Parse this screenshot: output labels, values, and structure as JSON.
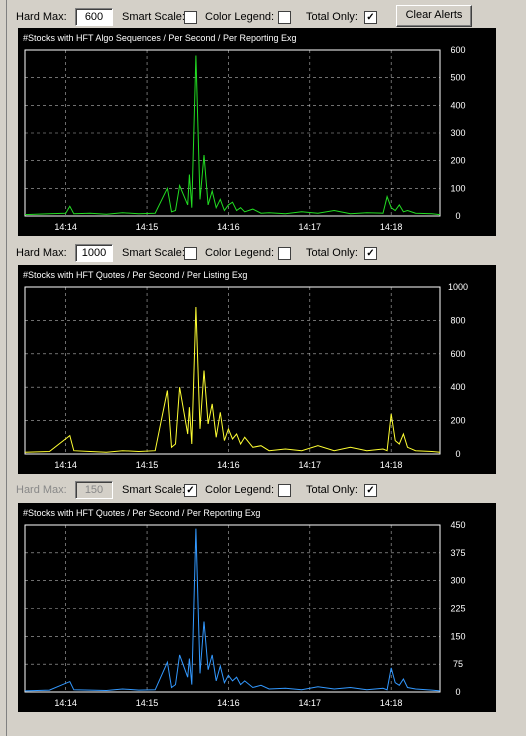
{
  "toolbar": {
    "clear_alerts_label": "Clear Alerts"
  },
  "panels": [
    {
      "controls": {
        "hard_max_label": "Hard Max:",
        "hard_max_value": "600",
        "hard_max_enabled": true,
        "smart_scale_label": "Smart Scale:",
        "smart_scale_checked": false,
        "color_legend_label": "Color Legend:",
        "color_legend_checked": false,
        "total_only_label": "Total Only:",
        "total_only_checked": true
      }
    },
    {
      "controls": {
        "hard_max_label": "Hard Max:",
        "hard_max_value": "1000",
        "hard_max_enabled": true,
        "smart_scale_label": "Smart Scale:",
        "smart_scale_checked": false,
        "color_legend_label": "Color Legend:",
        "color_legend_checked": false,
        "total_only_label": "Total Only:",
        "total_only_checked": true
      }
    },
    {
      "controls": {
        "hard_max_label": "Hard Max:",
        "hard_max_value": "150",
        "hard_max_enabled": false,
        "smart_scale_label": "Smart Scale:",
        "smart_scale_checked": true,
        "color_legend_label": "Color Legend:",
        "color_legend_checked": false,
        "total_only_label": "Total Only:",
        "total_only_checked": true
      }
    }
  ],
  "chart_data": [
    {
      "type": "line",
      "title": "#Stocks with HFT Algo Sequences / Per Second / Per Reporting Exg",
      "color": "#22dd22",
      "x_ticks": [
        "14:14",
        "14:15",
        "14:16",
        "14:17",
        "14:18"
      ],
      "x_tick_pos": [
        0.5,
        1.5,
        2.5,
        3.5,
        4.5
      ],
      "xlim": [
        0,
        5.1
      ],
      "ylim": [
        0,
        600
      ],
      "y_ticks": [
        0,
        100,
        200,
        300,
        400,
        500,
        600
      ],
      "grid": true,
      "series": [
        {
          "x": [
            0,
            0.3,
            0.5,
            0.55,
            0.6,
            0.8,
            1.0,
            1.2,
            1.4,
            1.6,
            1.75,
            1.8,
            1.85,
            1.9,
            2.0,
            2.02,
            2.05,
            2.1,
            2.15,
            2.2,
            2.25,
            2.3,
            2.35,
            2.4,
            2.45,
            2.5,
            2.55,
            2.6,
            2.65,
            2.7,
            2.8,
            2.9,
            3.0,
            3.2,
            3.4,
            3.6,
            3.8,
            4.0,
            4.2,
            4.4,
            4.45,
            4.5,
            4.55,
            4.6,
            4.65,
            4.7,
            4.8,
            5.0,
            5.1
          ],
          "y": [
            5,
            8,
            10,
            35,
            8,
            10,
            6,
            12,
            8,
            10,
            100,
            15,
            20,
            110,
            40,
            150,
            30,
            580,
            60,
            220,
            40,
            90,
            30,
            60,
            20,
            40,
            50,
            20,
            30,
            15,
            25,
            10,
            12,
            8,
            15,
            10,
            20,
            8,
            12,
            10,
            70,
            30,
            20,
            40,
            15,
            20,
            10,
            8,
            5
          ]
        }
      ]
    },
    {
      "type": "line",
      "title": "#Stocks with HFT Quotes / Per Second / Per Listing Exg",
      "color": "#ffff33",
      "x_ticks": [
        "14:14",
        "14:15",
        "14:16",
        "14:17",
        "14:18"
      ],
      "x_tick_pos": [
        0.5,
        1.5,
        2.5,
        3.5,
        4.5
      ],
      "xlim": [
        0,
        5.1
      ],
      "ylim": [
        0,
        1000
      ],
      "y_ticks": [
        0,
        200,
        400,
        600,
        800,
        1000
      ],
      "grid": true,
      "series": [
        {
          "x": [
            0,
            0.3,
            0.55,
            0.6,
            0.8,
            1.0,
            1.2,
            1.4,
            1.6,
            1.75,
            1.8,
            1.85,
            1.9,
            2.0,
            2.02,
            2.05,
            2.1,
            2.15,
            2.2,
            2.25,
            2.3,
            2.35,
            2.4,
            2.45,
            2.5,
            2.55,
            2.6,
            2.65,
            2.7,
            2.8,
            2.9,
            3.0,
            3.2,
            3.4,
            3.6,
            3.8,
            4.0,
            4.2,
            4.4,
            4.45,
            4.5,
            4.55,
            4.6,
            4.65,
            4.7,
            4.8,
            5.0,
            5.1
          ],
          "y": [
            10,
            15,
            110,
            20,
            15,
            10,
            20,
            15,
            20,
            380,
            40,
            60,
            400,
            120,
            280,
            60,
            880,
            150,
            500,
            180,
            300,
            100,
            250,
            80,
            150,
            90,
            120,
            60,
            100,
            40,
            50,
            20,
            30,
            20,
            50,
            20,
            40,
            20,
            30,
            20,
            240,
            80,
            60,
            120,
            40,
            20,
            15,
            10
          ]
        }
      ]
    },
    {
      "type": "line",
      "title": "#Stocks with HFT Quotes / Per Second / Per Reporting Exg",
      "color": "#3399ff",
      "x_ticks": [
        "14:14",
        "14:15",
        "14:16",
        "14:17",
        "14:18"
      ],
      "x_tick_pos": [
        0.5,
        1.5,
        2.5,
        3.5,
        4.5
      ],
      "xlim": [
        0,
        5.1
      ],
      "ylim": [
        0,
        450
      ],
      "y_ticks": [
        0,
        75,
        150,
        225,
        300,
        375,
        450
      ],
      "grid": true,
      "series": [
        {
          "x": [
            0,
            0.3,
            0.55,
            0.6,
            0.8,
            1.0,
            1.2,
            1.4,
            1.6,
            1.75,
            1.8,
            1.85,
            1.9,
            2.0,
            2.02,
            2.05,
            2.1,
            2.15,
            2.2,
            2.25,
            2.3,
            2.35,
            2.4,
            2.45,
            2.5,
            2.55,
            2.6,
            2.65,
            2.7,
            2.8,
            2.9,
            3.0,
            3.2,
            3.4,
            3.6,
            3.8,
            4.0,
            4.2,
            4.4,
            4.45,
            4.5,
            4.55,
            4.6,
            4.65,
            4.7,
            4.8,
            5.0,
            5.1
          ],
          "y": [
            3,
            5,
            28,
            6,
            5,
            4,
            8,
            5,
            6,
            80,
            12,
            20,
            100,
            40,
            90,
            20,
            440,
            50,
            190,
            60,
            100,
            30,
            70,
            25,
            45,
            30,
            40,
            20,
            30,
            12,
            18,
            8,
            10,
            6,
            14,
            8,
            12,
            6,
            10,
            6,
            65,
            25,
            18,
            35,
            12,
            8,
            5,
            3
          ]
        }
      ]
    }
  ]
}
